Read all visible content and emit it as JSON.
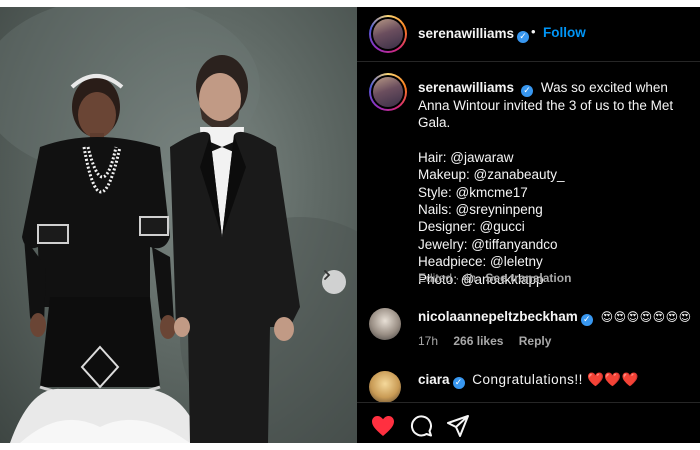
{
  "header": {
    "username": "serenawilliams",
    "separator": "•",
    "follow_label": "Follow"
  },
  "caption": {
    "username": "serenawilliams",
    "text": "Was so excited when Anna Wintour invited the 3 of us to the Met Gala.",
    "credits": [
      "Hair: @jawaraw",
      "Makeup: @zanabeauty_",
      "Style: @kmcme17",
      "Nails: @sreyninpeng",
      "Designer: @gucci",
      "Jewelry: @tiffanyandco",
      "Headpiece: @leletny",
      "Photo: @anoukklapp"
    ],
    "edited": "Edited · 4h",
    "see_translation": "See translation"
  },
  "comments": [
    {
      "username": "nicolaannepeltzbeckham",
      "text": "😍😍😍😍😍😍😍",
      "time": "17h",
      "likes": "266 likes",
      "reply": "Reply"
    },
    {
      "username": "ciara",
      "text": "Congratulations!! ❤️❤️❤️"
    }
  ],
  "icons": {
    "verified": "✓",
    "like": "heart-icon",
    "comment": "comment-icon",
    "share": "share-icon",
    "next": "chevron-right-icon"
  },
  "colors": {
    "like_red": "#ff3040",
    "link_blue": "#0095f6",
    "verified_blue": "#3897f0"
  }
}
